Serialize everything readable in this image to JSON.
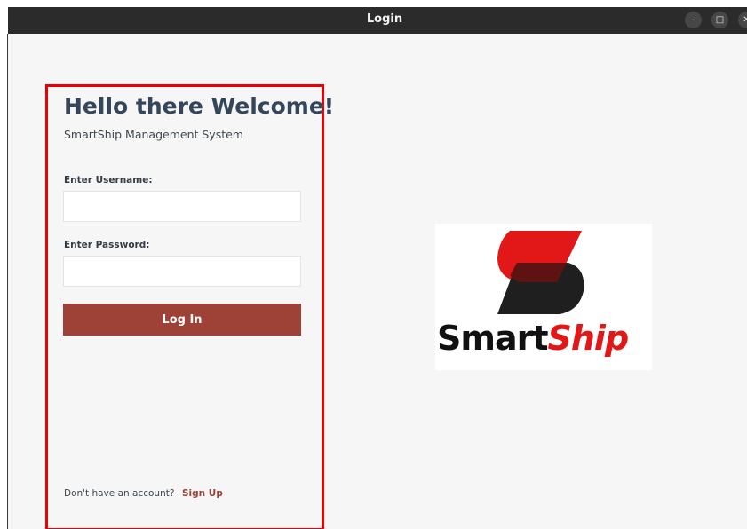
{
  "window": {
    "title": "Login",
    "minimize_glyph": "–",
    "maximize_glyph": "□",
    "close_glyph": "✕"
  },
  "login": {
    "heading": "Hello there Welcome!",
    "subtitle": "SmartShip Management System",
    "username_label": "Enter Username:",
    "username_value": "",
    "password_label": "Enter Password:",
    "password_value": "",
    "login_button": "Log In",
    "footer_text": "Don't have an account?",
    "signup_link": "Sign Up"
  },
  "logo": {
    "word_part1": "Smart",
    "word_part2": "Ship",
    "red": "#e21818",
    "dark": "#1f1f1f"
  },
  "colors": {
    "accent": "#9e4238",
    "panel_border": "#ee0000",
    "heading": "#34475a"
  }
}
